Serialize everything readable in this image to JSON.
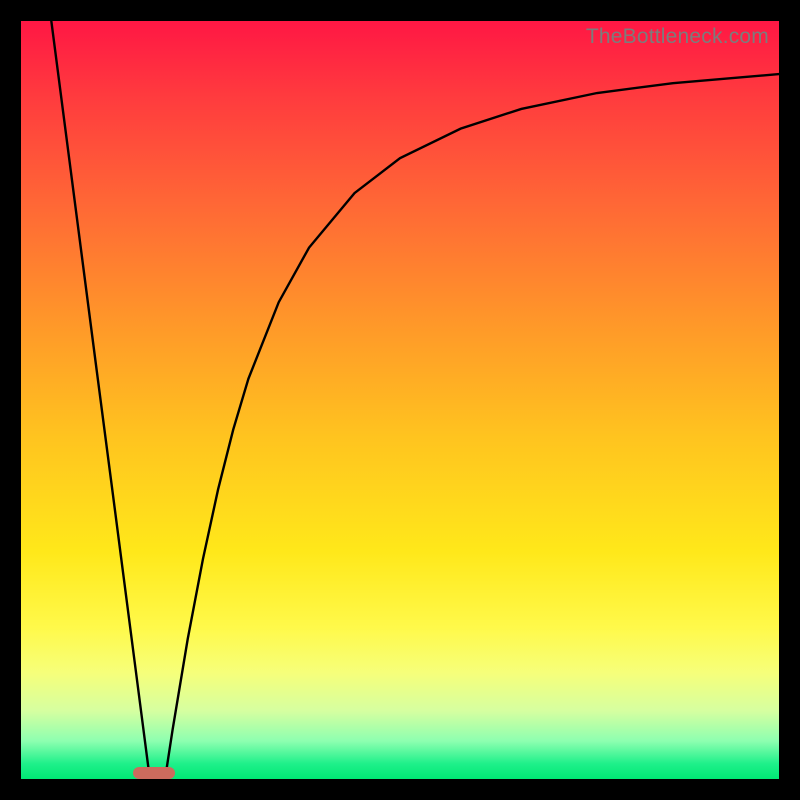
{
  "watermark": "TheBottleneck.com",
  "colors": {
    "frame_border": "#000000",
    "curve": "#000000",
    "pill": "#cc6b5d",
    "gradient_top": "#ff1744",
    "gradient_bottom": "#00e874"
  },
  "chart_data": {
    "type": "line",
    "title": "",
    "xlabel": "",
    "ylabel": "",
    "xlim": [
      0,
      100
    ],
    "ylim": [
      0,
      100
    ],
    "min_marker_x": 17.5,
    "series": [
      {
        "name": "left-branch",
        "x": [
          4.0,
          6.0,
          8.0,
          10.0,
          12.0,
          14.0,
          15.0,
          16.0,
          17.0
        ],
        "y": [
          100.0,
          84.6,
          69.2,
          53.8,
          38.5,
          23.1,
          15.4,
          7.7,
          0.0
        ]
      },
      {
        "name": "right-branch",
        "x": [
          19.0,
          20.0,
          22.0,
          24.0,
          26.0,
          28.0,
          30.0,
          34.0,
          38.0,
          44.0,
          50.0,
          58.0,
          66.0,
          76.0,
          86.0,
          100.0
        ],
        "y": [
          0.0,
          6.5,
          18.5,
          29.0,
          38.2,
          46.1,
          52.8,
          62.9,
          70.1,
          77.3,
          81.9,
          85.8,
          88.4,
          90.5,
          91.8,
          93.0
        ]
      }
    ]
  }
}
